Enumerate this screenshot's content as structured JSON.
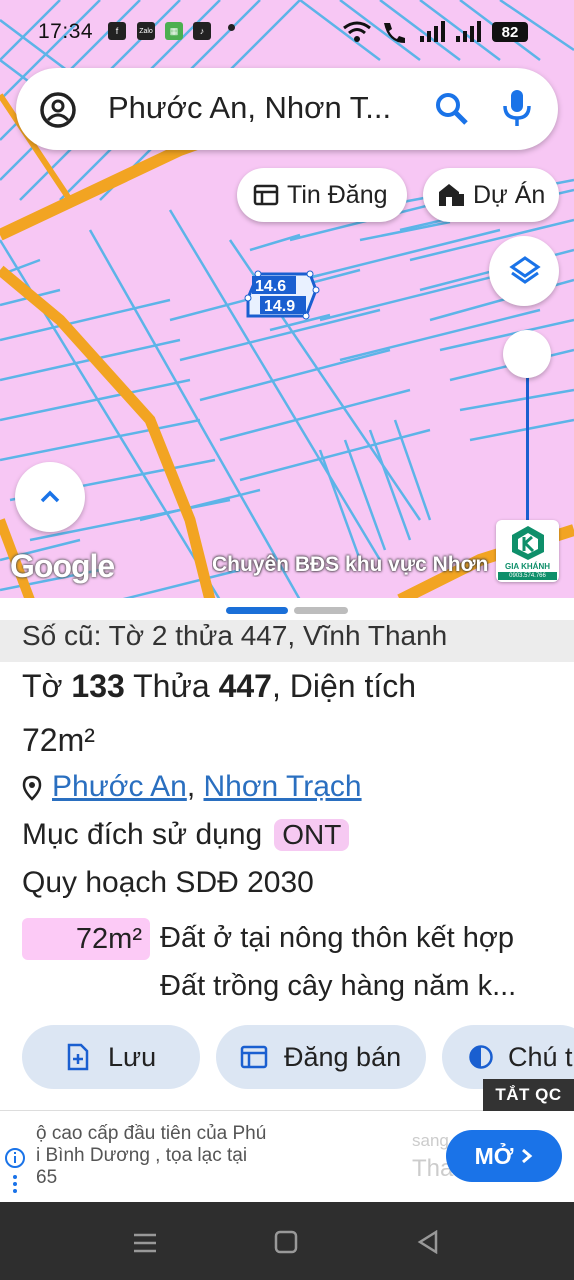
{
  "status_bar": {
    "time": "17:34",
    "battery": "82",
    "icons": [
      "facebook-icon",
      "zalo-icon",
      "app-icon",
      "tiktok-icon",
      "dot-icon",
      "wifi-icon",
      "call-icon",
      "signal-icon",
      "signal-icon"
    ]
  },
  "search": {
    "query": "Phước An, Nhơn T..."
  },
  "chips": {
    "tin_dang": "Tin Đăng",
    "du_an": "Dự Án"
  },
  "map": {
    "label_top": "14.6",
    "label_bottom": "14.9",
    "google": "Google",
    "watermark": "Chuyên BĐS khu vực Nhơn",
    "logo_text": "GIA KHÁNH",
    "logo_phone": "0903.574.766",
    "colors": {
      "land": "#f7c7f4",
      "lines": "#5db4e8",
      "road": "#f2a422"
    }
  },
  "parcel": {
    "old_ref": "Số cũ: Tờ 2 thửa 447, Vĩnh Thanh",
    "to_label": "Tờ",
    "to_value": "133",
    "thua_label": "Thửa",
    "thua_value": "447",
    "dien_tich_label": ", Diện tích",
    "area": "72m²",
    "commune": "Phước An",
    "district": "Nhơn Trạch",
    "purpose_label": "Mục đích sử dụng",
    "purpose_code": "ONT",
    "plan_label": "Quy hoạch SDĐ 2030",
    "plan_area": "72m²",
    "plan_line1": "Đất ở tại nông thôn kết hợp",
    "plan_line2": "Đất trồng cây hàng năm k..."
  },
  "actions": {
    "save": "Lưu",
    "sell": "Đăng bán",
    "note": "Chú t"
  },
  "ad": {
    "close_label": "TẮT QC",
    "line1": "ộ cao cấp đầu tiên của Phú",
    "line2": "i Bình Dương , tọa lạc tại",
    "line3": "65",
    "faded1": "sang",
    "faded2": "Tha",
    "open": "MỞ"
  }
}
